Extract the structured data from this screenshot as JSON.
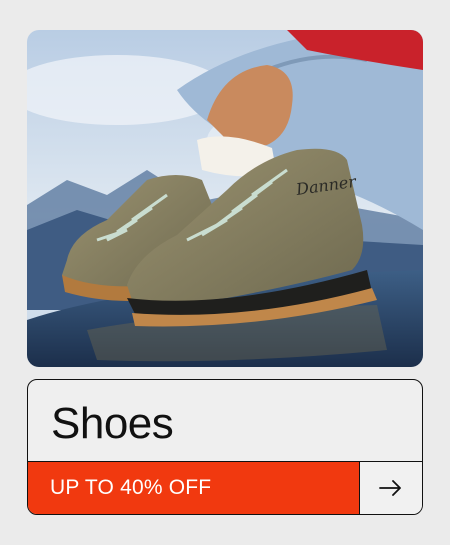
{
  "product": {
    "image_alt": "Hiking boots",
    "image_brand": "Danner",
    "title": "Shoes",
    "promo_label": "UP TO 40% OFF",
    "arrow_icon": "arrow-right-icon"
  },
  "colors": {
    "background": "#ebebeb",
    "promo": "#f1390f",
    "border": "#111111"
  }
}
